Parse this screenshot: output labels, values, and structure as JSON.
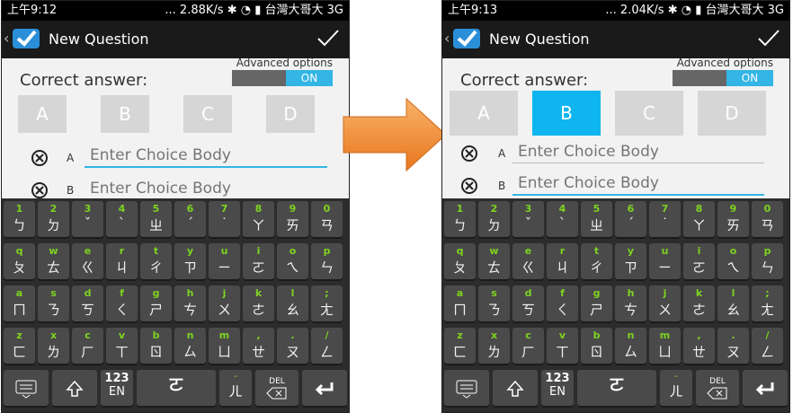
{
  "phones": [
    {
      "status": {
        "time": "上午9:12",
        "speed": "... 2.88K/s",
        "carrier": "台灣大哥大 3G"
      },
      "title": "New Question",
      "correct_label": "Correct answer:",
      "adv_label": "Advanced options",
      "toggle_on": "ON",
      "choices": [
        "A",
        "B",
        "C",
        "D"
      ],
      "selected": null,
      "rows": [
        {
          "letter": "A",
          "placeholder": "Enter Choice Body"
        },
        {
          "letter": "B",
          "placeholder": "Enter Choice Body"
        }
      ]
    },
    {
      "status": {
        "time": "上午9:13",
        "speed": "... 2.04K/s",
        "carrier": "台灣大哥大 3G"
      },
      "title": "New Question",
      "correct_label": "Correct answer:",
      "adv_label": "Advanced options",
      "toggle_on": "ON",
      "choices": [
        "A",
        "B",
        "C",
        "D"
      ],
      "selected": "B",
      "rows": [
        {
          "letter": "A",
          "placeholder": "Enter Choice Body"
        },
        {
          "letter": "B",
          "placeholder": "Enter Choice Body"
        }
      ]
    }
  ],
  "keyboard": {
    "rows": [
      [
        [
          "1",
          "ㄅ"
        ],
        [
          "2",
          "ㄉ"
        ],
        [
          "3",
          "ˇ"
        ],
        [
          "4",
          "ˋ"
        ],
        [
          "5",
          "ㄓ"
        ],
        [
          "6",
          "ˊ"
        ],
        [
          "7",
          "˙"
        ],
        [
          "8",
          "ㄚ"
        ],
        [
          "9",
          "ㄞ"
        ],
        [
          "0",
          "ㄢ"
        ]
      ],
      [
        [
          "q",
          "ㄆ"
        ],
        [
          "w",
          "ㄊ"
        ],
        [
          "e",
          "ㄍ"
        ],
        [
          "r",
          "ㄐ"
        ],
        [
          "t",
          "ㄔ"
        ],
        [
          "y",
          "ㄗ"
        ],
        [
          "u",
          "ㄧ"
        ],
        [
          "i",
          "ㄛ"
        ],
        [
          "o",
          "ㄟ"
        ],
        [
          "p",
          "ㄣ"
        ]
      ],
      [
        [
          "a",
          "ㄇ"
        ],
        [
          "s",
          "ㄋ"
        ],
        [
          "d",
          "ㄎ"
        ],
        [
          "f",
          "ㄑ"
        ],
        [
          "g",
          "ㄕ"
        ],
        [
          "h",
          "ㄘ"
        ],
        [
          "j",
          "ㄨ"
        ],
        [
          "k",
          "ㄜ"
        ],
        [
          "l",
          "ㄠ"
        ],
        [
          ";",
          "ㄤ"
        ]
      ],
      [
        [
          "z",
          "ㄈ"
        ],
        [
          "x",
          "ㄌ"
        ],
        [
          "c",
          "ㄏ"
        ],
        [
          "v",
          "ㄒ"
        ],
        [
          "b",
          "ㄖ"
        ],
        [
          "n",
          "ㄙ"
        ],
        [
          "m",
          "ㄩ"
        ],
        [
          ",",
          "ㄝ"
        ],
        [
          ".",
          "ㄡ"
        ],
        [
          "/",
          "ㄥ"
        ]
      ]
    ],
    "bottom": {
      "num_top": "123",
      "num_bottom": "EN",
      "space_label": "ㄛ",
      "dash": "-",
      "er": "ㄦ",
      "del": "DEL"
    }
  },
  "icons": {
    "back": "chevron-left-icon",
    "app": "app-check-icon",
    "done": "checkmark-icon",
    "clear": "circle-x-icon",
    "keyboard": "keyboard-icon",
    "shift": "shift-icon",
    "backspace": "backspace-icon",
    "enter": "enter-icon",
    "arrow": "right-arrow-icon"
  },
  "colors": {
    "accent": "#33b5e5",
    "selected": "#0fb5ee",
    "arrow": "#f08a24",
    "key_sub": "#7ed321"
  }
}
